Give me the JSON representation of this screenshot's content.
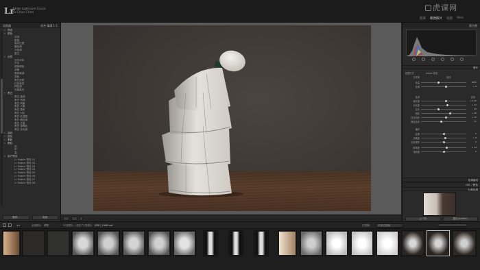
{
  "app": {
    "logo": "Lr",
    "identity_line1": "Adobe Lightroom Classic",
    "identity_line2": "Yu Chun Chen",
    "modules": [
      "图库",
      "修改照片",
      "地图",
      "Web"
    ],
    "active_module": "修改照片",
    "watermark": "虎课网"
  },
  "left_panel": {
    "header_title": "导航器",
    "header_opts": "适合  填满  1:1",
    "sub_header": "预设",
    "items": [
      {
        "label": "颜色",
        "level": 1,
        "folder": true
      },
      {
        "label": "自然",
        "level": 2
      },
      {
        "label": "鲜艳",
        "level": 2
      },
      {
        "label": "高对比度",
        "level": 2
      },
      {
        "label": "暖色调",
        "level": 2
      },
      {
        "label": "冷色调",
        "level": 2
      },
      {
        "label": "复古",
        "level": 2
      },
      {
        "label": "创意",
        "level": 1,
        "folder": true
      },
      {
        "label": "交叉冲印",
        "level": 2
      },
      {
        "label": "冷淡",
        "level": 2
      },
      {
        "label": "超饱和色",
        "level": 2
      },
      {
        "label": "浓郁",
        "level": 2
      },
      {
        "label": "柔和暗调",
        "level": 2
      },
      {
        "label": "褪色",
        "level": 2
      },
      {
        "label": "黑白滤镜",
        "level": 2
      },
      {
        "label": "红色渐变",
        "level": 2
      },
      {
        "label": "褐色调",
        "level": 2
      },
      {
        "label": "亮度高光",
        "level": 2
      },
      {
        "label": "黑白",
        "level": 1,
        "folder": true
      },
      {
        "label": "黑白 高调",
        "level": 2
      },
      {
        "label": "黑白 低调",
        "level": 2
      },
      {
        "label": "黑白 风景",
        "level": 2
      },
      {
        "label": "黑白 人像",
        "level": 2
      },
      {
        "label": "黑白 柔和",
        "level": 2
      },
      {
        "label": "黑白 对比",
        "level": 2
      },
      {
        "label": "黑白 红滤镜",
        "level": 2
      },
      {
        "label": "黑白 硒色调",
        "level": 2
      },
      {
        "label": "黑白 平面",
        "level": 2
      },
      {
        "label": "黑白 深褐色",
        "level": 2
      },
      {
        "label": "黑白 冷色调",
        "level": 2
      },
      {
        "label": "曲线",
        "level": 1,
        "folder": true
      },
      {
        "label": "锐化",
        "level": 1,
        "folder": true
      },
      {
        "label": "晕影",
        "level": 1,
        "folder": true
      },
      {
        "label": "颗粒",
        "level": 1,
        "folder": true
      },
      {
        "label": "低",
        "level": 2
      },
      {
        "label": "中",
        "level": 2
      },
      {
        "label": "高",
        "level": 2
      },
      {
        "label": "用户预设",
        "level": 1,
        "folder": true
      },
      {
        "label": "Lr Mobile 预设 01",
        "level": 2
      },
      {
        "label": "Lr Mobile 预设 02",
        "level": 2
      },
      {
        "label": "Lr Mobile 预设 03",
        "level": 2
      },
      {
        "label": "Lr Mobile 预设 04",
        "level": 2
      },
      {
        "label": "Lr Mobile 预设 05",
        "level": 2
      },
      {
        "label": "Lr Mobile 预设 06",
        "level": 2
      },
      {
        "label": "Lr Mobile 预设 07",
        "level": 2
      },
      {
        "label": "Lr Mobile 预设 08",
        "level": 2
      }
    ],
    "btn_copy": "复制...",
    "btn_paste": "粘贴"
  },
  "right_panel": {
    "header_title": "直方图",
    "section_basic": "基本",
    "profile_label": "处理方式",
    "profile_value": "Adobe 颜色",
    "wb_label": "白平衡",
    "wb_value": "自动",
    "tone_label": "色调",
    "tone_auto": "自动",
    "presence_label": "偏好",
    "sliders": [
      {
        "name": "色温",
        "value": "4950"
      },
      {
        "name": "色调",
        "value": "+ 9"
      },
      {
        "name": "曝光度",
        "value": "+ 0.40"
      },
      {
        "name": "对比度",
        "value": "+ 12"
      },
      {
        "name": "高光",
        "value": "- 35"
      },
      {
        "name": "阴影",
        "value": "+ 28"
      },
      {
        "name": "白色色阶",
        "value": "+ 10"
      },
      {
        "name": "黑色色阶",
        "value": "- 12"
      },
      {
        "name": "纹理",
        "value": "0"
      },
      {
        "name": "清晰度",
        "value": "+ 8"
      },
      {
        "name": "去除薄雾",
        "value": "0"
      },
      {
        "name": "鲜艳度",
        "value": "+ 14"
      },
      {
        "name": "饱和度",
        "value": "0"
      }
    ],
    "collapsed_sections": [
      "色调曲线",
      "HSL / 颜色",
      "分离色调"
    ],
    "btn_prev": "上一张",
    "btn_reset": "复位(Adobe)"
  },
  "filmstrip_bar": {
    "label_source": "全部照片 · 调整",
    "label_count": "20张照片 / 选定了1张照片",
    "label_file": "/DSC_1968.nef",
    "filter_label": "过滤器：",
    "filter_value": "关闭过滤器"
  },
  "colors": {
    "accent": "#bdbdbd",
    "panel_bg": "#2a2a2a",
    "photo_wall": "#3d3734",
    "table_wood": "#5b3e2b"
  }
}
